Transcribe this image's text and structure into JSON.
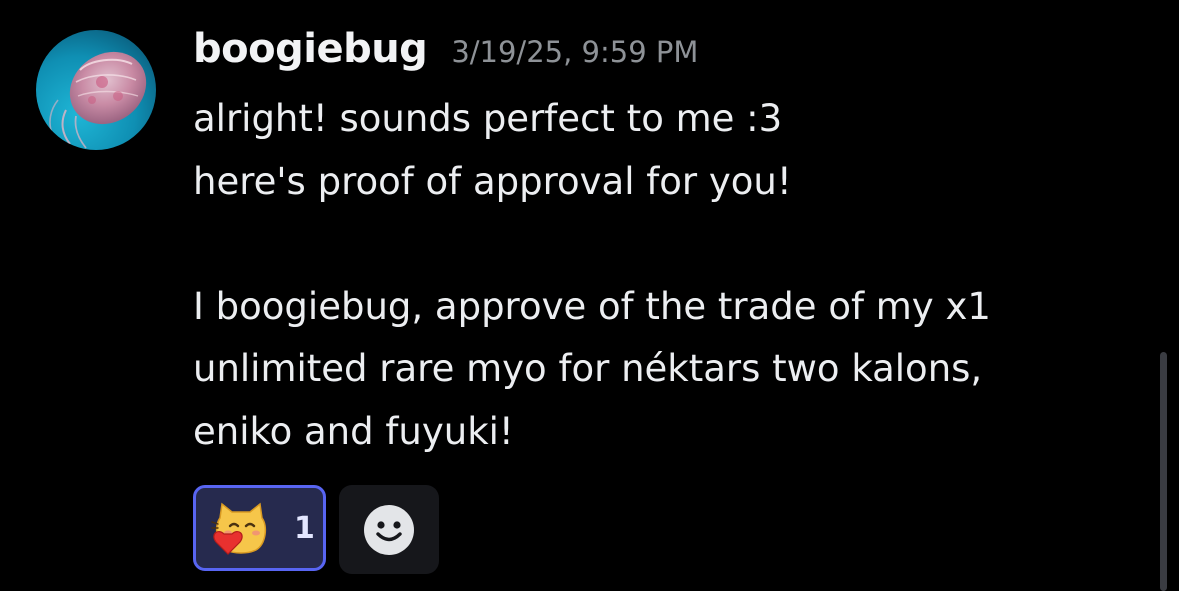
{
  "message": {
    "author": "boogiebug",
    "timestamp": "3/19/25, 9:59 PM",
    "avatar_icon": "jellyfish-avatar",
    "lines": [
      "alright! sounds perfect to me :3",
      "here's proof of approval for you!",
      "",
      "I boogiebug, approve of the trade of my x1",
      "unlimited rare myo for néktars two kalons,",
      "eniko and fuyuki!"
    ]
  },
  "reactions": [
    {
      "emoji_icon": "cat-heart-emoji",
      "count": "1",
      "selected": true
    }
  ],
  "add_reaction": {
    "icon": "smiley-face-icon"
  },
  "colors": {
    "background": "#000000",
    "username": "#f2f3f5",
    "timestamp": "#8e9297",
    "text": "#eceef1",
    "reaction_border": "#5865f2",
    "reaction_bg": "#262a4e",
    "add_reaction_bg": "#16171b"
  }
}
